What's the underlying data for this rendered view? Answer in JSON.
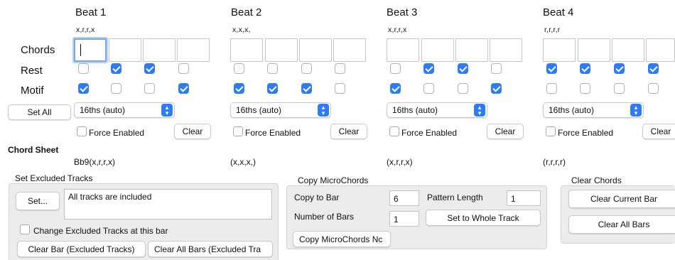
{
  "beats": [
    {
      "title": "Beat 1",
      "pattern": "x,r,r,x",
      "rest": [
        false,
        true,
        true,
        false
      ],
      "motif": [
        true,
        false,
        false,
        true
      ],
      "resolution": "16ths (auto)",
      "force_label": "Force Enabled",
      "clear_label": "Clear",
      "chord": "Bb9(x,r,r,x)"
    },
    {
      "title": "Beat 2",
      "pattern": "x,x,x,",
      "rest": [
        false,
        false,
        false,
        false
      ],
      "motif": [
        true,
        true,
        true,
        false
      ],
      "resolution": "16ths (auto)",
      "force_label": "Force Enabled",
      "clear_label": "Clear",
      "chord": "(x,x,x,)"
    },
    {
      "title": "Beat 3",
      "pattern": "x,r,r,x",
      "rest": [
        false,
        true,
        true,
        false
      ],
      "motif": [
        true,
        false,
        false,
        true
      ],
      "resolution": "16ths (auto)",
      "force_label": "Force Enabled",
      "clear_label": "Clear",
      "chord": "(x,r,r,x)"
    },
    {
      "title": "Beat 4",
      "pattern": "r,r,r,r",
      "rest": [
        true,
        true,
        true,
        true
      ],
      "motif": [
        false,
        false,
        false,
        false
      ],
      "resolution": "16ths (auto)",
      "force_label": "Force Enabled",
      "clear_label": "Clear",
      "chord": "(r,r,r,r)"
    }
  ],
  "labels": {
    "chords": "Chords",
    "rest": "Rest",
    "motif": "Motif",
    "set_all": "Set All",
    "chord_sheet": "Chord Sheet"
  },
  "excluded": {
    "title": "Set Excluded Tracks",
    "set_button": "Set...",
    "info": "All tracks are included",
    "change_label": "Change Excluded Tracks at this bar",
    "clear_bar": "Clear Bar (Excluded Tracks)",
    "clear_all": "Clear All Bars (Excluded Tra"
  },
  "copy": {
    "title": "Copy MicroChords",
    "copy_to_bar_label": "Copy to Bar",
    "copy_to_bar_value": "6",
    "pattern_length_label": "Pattern Length",
    "pattern_length_value": "1",
    "number_of_bars_label": "Number of Bars",
    "number_of_bars_value": "1",
    "whole_track": "Set to Whole Track",
    "copy_now": "Copy MicroChords Nc"
  },
  "clear_chords": {
    "title": "Clear Chords",
    "current": "Clear Current Bar",
    "all": "Clear All Bars"
  },
  "colors": {
    "accent": "#2d7cf5",
    "panel": "#ececec"
  }
}
